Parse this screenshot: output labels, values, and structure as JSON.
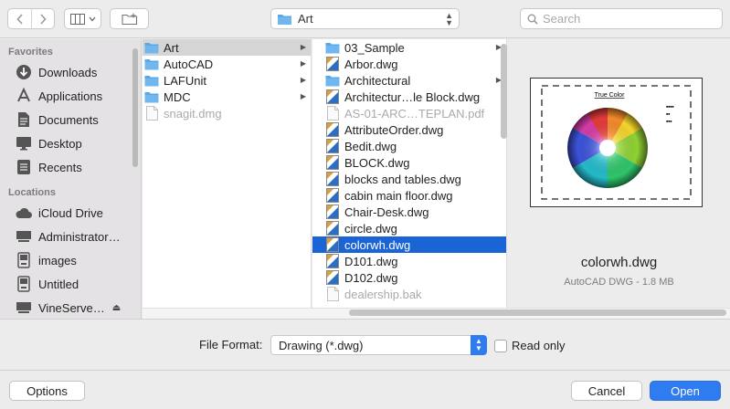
{
  "toolbar": {
    "path_label": "Art",
    "search_placeholder": "Search"
  },
  "sidebar": {
    "favorites_header": "Favorites",
    "favorites": [
      {
        "label": "Downloads",
        "icon": "downloads-icon"
      },
      {
        "label": "Applications",
        "icon": "applications-icon"
      },
      {
        "label": "Documents",
        "icon": "documents-icon"
      },
      {
        "label": "Desktop",
        "icon": "desktop-icon"
      },
      {
        "label": "Recents",
        "icon": "recents-icon"
      }
    ],
    "locations_header": "Locations",
    "locations": [
      {
        "label": "iCloud Drive",
        "icon": "cloud-icon"
      },
      {
        "label": "Administrator…",
        "icon": "monitor-icon"
      },
      {
        "label": "images",
        "icon": "disk-icon"
      },
      {
        "label": "Untitled",
        "icon": "disk-icon"
      },
      {
        "label": "VineServe…",
        "icon": "monitor-icon"
      }
    ]
  },
  "column1": [
    {
      "label": "Art",
      "type": "folder",
      "state": "highlighted",
      "arrow": true
    },
    {
      "label": "AutoCAD",
      "type": "folder",
      "arrow": true
    },
    {
      "label": "LAFUnit",
      "type": "folder",
      "arrow": true
    },
    {
      "label": "MDC",
      "type": "folder",
      "arrow": true
    },
    {
      "label": "snagit.dmg",
      "type": "doc",
      "state": "dim"
    }
  ],
  "column2": [
    {
      "label": "03_Sample",
      "type": "folder",
      "arrow": true
    },
    {
      "label": "Arbor.dwg",
      "type": "dwg"
    },
    {
      "label": "Architectural",
      "type": "folder",
      "arrow": true
    },
    {
      "label": "Architectur…le Block.dwg",
      "type": "dwg"
    },
    {
      "label": "AS-01-ARC…TEPLAN.pdf",
      "type": "doc",
      "state": "dim"
    },
    {
      "label": "AttributeOrder.dwg",
      "type": "dwg"
    },
    {
      "label": "Bedit.dwg",
      "type": "dwg"
    },
    {
      "label": "BLOCK.dwg",
      "type": "dwg"
    },
    {
      "label": "blocks and tables.dwg",
      "type": "dwg"
    },
    {
      "label": "cabin main floor.dwg",
      "type": "dwg"
    },
    {
      "label": "Chair-Desk.dwg",
      "type": "dwg"
    },
    {
      "label": "circle.dwg",
      "type": "dwg"
    },
    {
      "label": "colorwh.dwg",
      "type": "dwg",
      "state": "selected"
    },
    {
      "label": "D101.dwg",
      "type": "dwg"
    },
    {
      "label": "D102.dwg",
      "type": "dwg"
    },
    {
      "label": "dealership.bak",
      "type": "doc",
      "state": "dim"
    }
  ],
  "preview": {
    "thumb_title": "True Color",
    "file_name": "colorwh.dwg",
    "file_info": "AutoCAD DWG - 1.8 MB"
  },
  "format": {
    "label": "File Format:",
    "value": "Drawing (*.dwg)",
    "readonly_label": "Read only"
  },
  "buttons": {
    "options": "Options",
    "cancel": "Cancel",
    "open": "Open"
  },
  "colors": {
    "accent": "#2f7bf0",
    "selection": "#1b64d6",
    "folder": "#5aa8e6"
  }
}
